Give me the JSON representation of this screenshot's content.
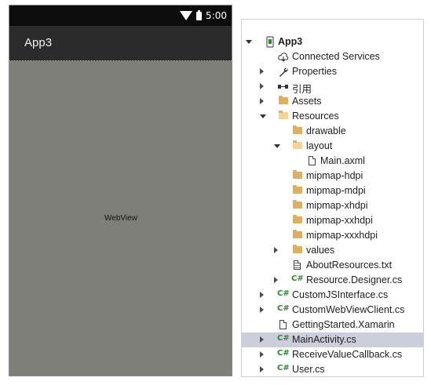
{
  "phone": {
    "status_time": "5:00",
    "app_title": "App3",
    "webview_label": "WebView"
  },
  "explorer": {
    "header_fragment": "·· ·· · ··· ·· · ·· ···",
    "items": [
      {
        "label": "App3",
        "icon": "android-project-icon",
        "arrow": "expanded",
        "level": 0,
        "bold": true
      },
      {
        "label": "Connected Services",
        "icon": "cloud-icon",
        "arrow": "none",
        "level": 1
      },
      {
        "label": "Properties",
        "icon": "wrench-icon",
        "arrow": "collapsed",
        "level": 1
      },
      {
        "label": "引用",
        "icon": "references-icon",
        "arrow": "collapsed",
        "level": 1
      },
      {
        "label": "Assets",
        "icon": "folder-icon",
        "arrow": "collapsed",
        "level": 1
      },
      {
        "label": "Resources",
        "icon": "folder-open-icon",
        "arrow": "expanded",
        "level": 1
      },
      {
        "label": "drawable",
        "icon": "folder-icon",
        "arrow": "none",
        "level": 2
      },
      {
        "label": "layout",
        "icon": "folder-open-icon",
        "arrow": "expanded",
        "level": 2
      },
      {
        "label": "Main.axml",
        "icon": "file-icon",
        "arrow": "none",
        "level": 3
      },
      {
        "label": "mipmap-hdpi",
        "icon": "folder-icon",
        "arrow": "none",
        "level": 2
      },
      {
        "label": "mipmap-mdpi",
        "icon": "folder-icon",
        "arrow": "none",
        "level": 2
      },
      {
        "label": "mipmap-xhdpi",
        "icon": "folder-icon",
        "arrow": "none",
        "level": 2
      },
      {
        "label": "mipmap-xxhdpi",
        "icon": "folder-icon",
        "arrow": "none",
        "level": 2
      },
      {
        "label": "mipmap-xxxhdpi",
        "icon": "folder-icon",
        "arrow": "none",
        "level": 2
      },
      {
        "label": "values",
        "icon": "folder-icon",
        "arrow": "collapsed",
        "level": 2
      },
      {
        "label": "AboutResources.txt",
        "icon": "text-file-icon",
        "arrow": "none",
        "level": 2
      },
      {
        "label": "Resource.Designer.cs",
        "icon": "csharp-icon",
        "arrow": "collapsed",
        "level": 2
      },
      {
        "label": "CustomJSInterface.cs",
        "icon": "csharp-icon",
        "arrow": "collapsed",
        "level": 1
      },
      {
        "label": "CustomWebViewClient.cs",
        "icon": "csharp-icon",
        "arrow": "collapsed",
        "level": 1
      },
      {
        "label": "GettingStarted.Xamarin",
        "icon": "file-icon",
        "arrow": "none",
        "level": 1
      },
      {
        "label": "MainActivity.cs",
        "icon": "csharp-icon",
        "arrow": "collapsed",
        "level": 1,
        "selected": true
      },
      {
        "label": "ReceiveValueCallback.cs",
        "icon": "csharp-icon",
        "arrow": "collapsed",
        "level": 1
      },
      {
        "label": "User.cs",
        "icon": "csharp-icon",
        "arrow": "collapsed",
        "level": 1
      }
    ]
  },
  "colors": {
    "statusbar": "#0d0d0d",
    "appbar": "#2b2b2b",
    "webview_bg": "#7f7f7a",
    "selection": "#cccedb",
    "folder": "#dcb05e",
    "csharp": "#2b8a2b"
  }
}
